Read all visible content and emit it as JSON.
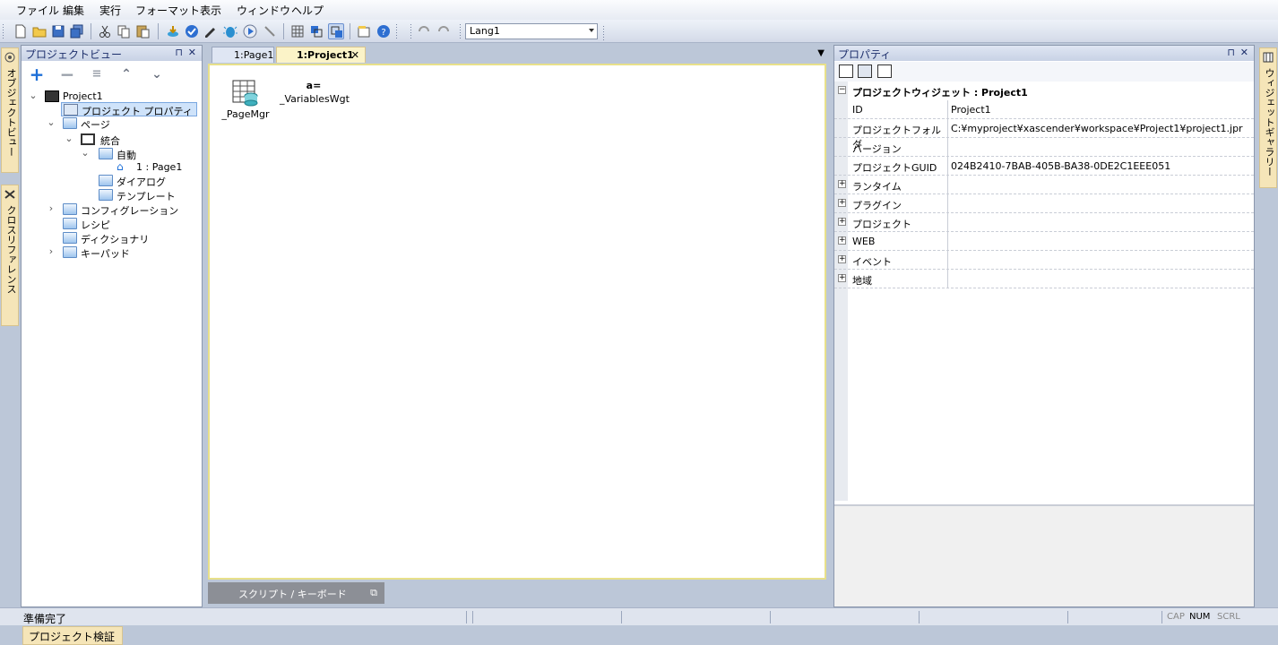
{
  "menu": [
    "ファイル",
    "編集",
    "実行",
    "フォーマット",
    "表示",
    "ウィンドウ",
    "ヘルプ"
  ],
  "toolbar": {
    "language": "Lang1"
  },
  "side_tabs": {
    "object_view": "オブジェクトビュー",
    "cross_reference": "クロスリファレンス",
    "widget_gallery": "ウィジェットギャラリー"
  },
  "project_view": {
    "title": "プロジェクトビュー",
    "tree": {
      "root": "Project1",
      "project_properties": "プロジェクト プロパティ",
      "pages": "ページ",
      "integrated": "統合",
      "auto": "自動",
      "page1": "1 : Page1",
      "dialog": "ダイアログ",
      "template": "テンプレート",
      "configuration": "コンフィグレーション",
      "recipe": "レシピ",
      "dictionary": "ディクショナリ",
      "keypad": "キーパッド"
    }
  },
  "editor": {
    "tabs": [
      "1:Page1",
      "1:Project1"
    ],
    "widgets": [
      {
        "label": "_PageMgr"
      },
      {
        "caption": "a=",
        "label": "_VariablesWgt"
      }
    ],
    "script_tab": "スクリプト / キーボード"
  },
  "properties": {
    "title": "プロパティ",
    "group": "プロジェクトウィジェット : Project1",
    "rows": [
      {
        "key": "ID",
        "value": "Project1"
      },
      {
        "key": "プロジェクトフォルダ",
        "value": "C:¥myproject¥xascender¥workspace¥Project1¥project1.jpr"
      },
      {
        "key": "バージョン",
        "value": ""
      },
      {
        "key": "プロジェクトGUID",
        "value": "024B2410-7BAB-405B-BA38-0DE2C1EEE051"
      }
    ],
    "groups": [
      "ランタイム",
      "プラグイン",
      "プロジェクト",
      "WEB",
      "イベント",
      "地域"
    ]
  },
  "status": {
    "text": "準備完了",
    "indicators": [
      "CAP",
      "NUM",
      "SCRL"
    ],
    "bottom_tab": "プロジェクト検証"
  },
  "colors": {
    "accent": "#1d6fd8",
    "tab_highlight": "#f5e5b8",
    "active_tab": "#fbf3c8"
  }
}
